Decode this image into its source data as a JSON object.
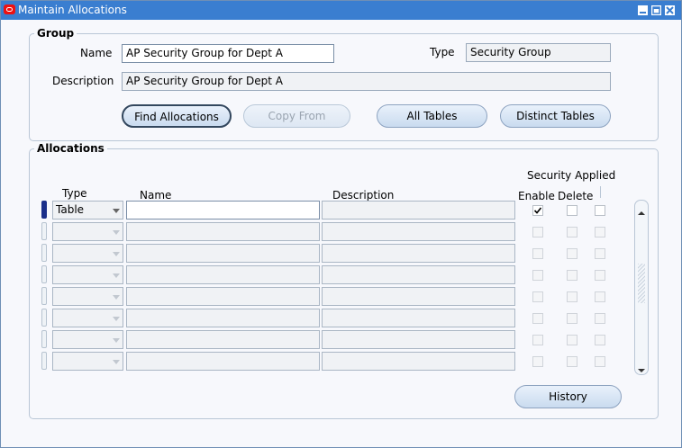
{
  "window": {
    "title": "Maintain Allocations"
  },
  "group": {
    "legend": "Group",
    "name_label": "Name",
    "name_value": "AP Security Group for Dept A",
    "type_label": "Type",
    "type_value": "Security Group",
    "description_label": "Description",
    "description_value": "AP Security Group for Dept A",
    "buttons": {
      "find": "Find Allocations",
      "copy": "Copy From",
      "all_tables": "All Tables",
      "distinct_tables": "Distinct Tables"
    }
  },
  "allocations": {
    "legend": "Allocations",
    "security_applied_label": "Security Applied",
    "columns": {
      "type": "Type",
      "name": "Name",
      "description": "Description",
      "enable": "Enable",
      "delete": "Delete"
    },
    "rows": [
      {
        "type": "Table",
        "name": "",
        "description": "",
        "enable": true,
        "delete": false,
        "extra": false
      },
      {
        "type": "",
        "name": "",
        "description": "",
        "enable": false,
        "delete": false,
        "extra": false
      },
      {
        "type": "",
        "name": "",
        "description": "",
        "enable": false,
        "delete": false,
        "extra": false
      },
      {
        "type": "",
        "name": "",
        "description": "",
        "enable": false,
        "delete": false,
        "extra": false
      },
      {
        "type": "",
        "name": "",
        "description": "",
        "enable": false,
        "delete": false,
        "extra": false
      },
      {
        "type": "",
        "name": "",
        "description": "",
        "enable": false,
        "delete": false,
        "extra": false
      },
      {
        "type": "",
        "name": "",
        "description": "",
        "enable": false,
        "delete": false,
        "extra": false
      },
      {
        "type": "",
        "name": "",
        "description": "",
        "enable": false,
        "delete": false,
        "extra": false
      }
    ],
    "history_button": "History"
  },
  "icons": [
    "app-icon",
    "minimize-icon",
    "maximize-icon",
    "close-icon",
    "dropdown-arrow-icon",
    "checkmark-icon",
    "scroll-up-icon",
    "scroll-down-icon"
  ],
  "colors": {
    "titlebar": "#3a7ed0",
    "row_indicator": "#1b2f8a",
    "button_fill": "#c9dbef"
  }
}
